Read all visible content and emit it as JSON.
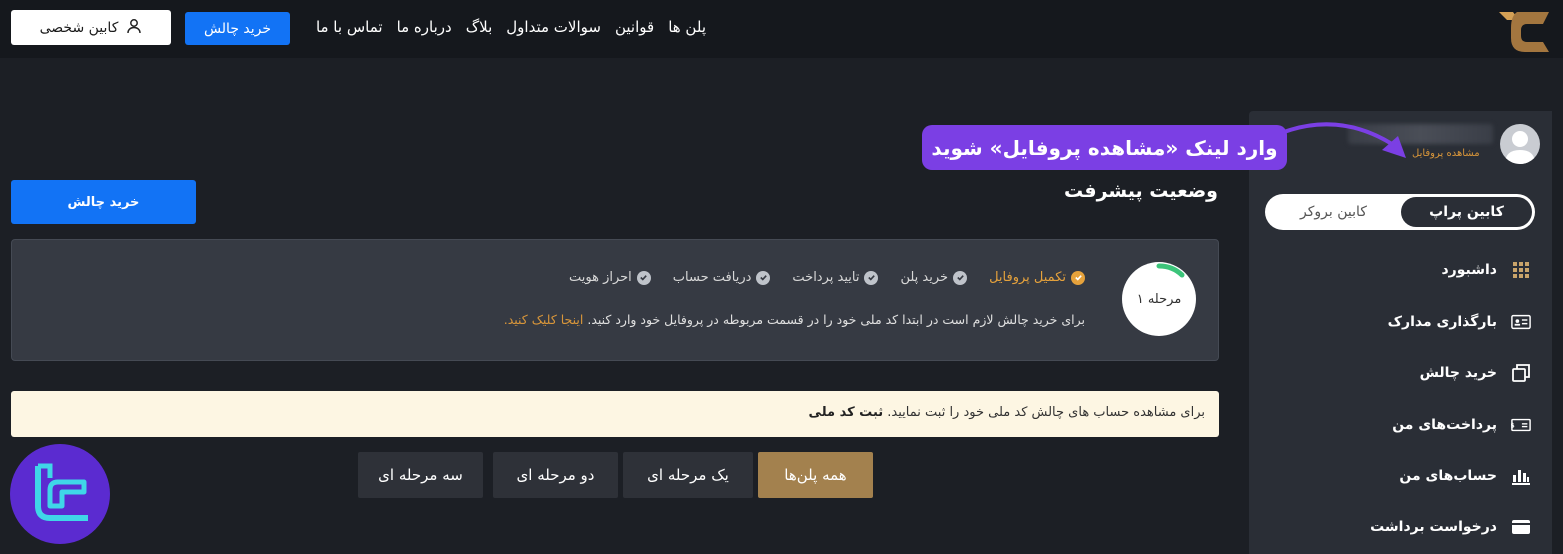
{
  "header": {
    "cabinet_button": "کابین شخصی",
    "buy_button": "خرید چالش",
    "nav": [
      "پلن ها",
      "قوانین",
      "سوالات متداول",
      "بلاگ",
      "درباره ما",
      "تماس با ما"
    ]
  },
  "sidebar": {
    "profile_link": "مشاهده پروفایل",
    "toggle_active": "کابین پراپ",
    "toggle_inactive": "کابین بروکر",
    "items": [
      {
        "label": "داشبورد",
        "icon": "grid-icon"
      },
      {
        "label": "بارگذاری مدارک",
        "icon": "id-card-icon"
      },
      {
        "label": "خرید چالش",
        "icon": "copy-icon"
      },
      {
        "label": "پرداخت‌های من",
        "icon": "bill-icon"
      },
      {
        "label": "حساب‌های من",
        "icon": "bar-chart-icon"
      },
      {
        "label": "درخواست برداشت",
        "icon": "wallet-icon"
      }
    ]
  },
  "callout": {
    "text": "وارد لینک «مشاهده پروفایل» شوید"
  },
  "main": {
    "buy_button": "خرید چالش",
    "title": "وضعیت پیشرفت",
    "progress": {
      "step_label": "مرحله ۱",
      "steps": [
        "تکمیل پروفایل",
        "خرید پلن",
        "تایید پرداخت",
        "دریافت حساب",
        "احراز هویت"
      ],
      "description": "برای خرید چالش لازم است در ابتدا کد ملی خود را در قسمت مربوطه در پروفایل خود وارد کنید.",
      "link": "اینجا کلیک کنید."
    },
    "notice": {
      "text": "برای مشاهده حساب های چالش کد ملی خود را ثبت نمایید.",
      "bold": "ثبت کد ملی"
    },
    "filters": [
      "همه پلن‌ها",
      "یک مرحله ای",
      "دو مرحله ای",
      "سه مرحله ای"
    ]
  },
  "colors": {
    "accent_blue": "#1273f5",
    "accent_gold": "#a3814e",
    "callout_purple": "#7b3fe4",
    "progress_orange": "#e6a23c"
  }
}
